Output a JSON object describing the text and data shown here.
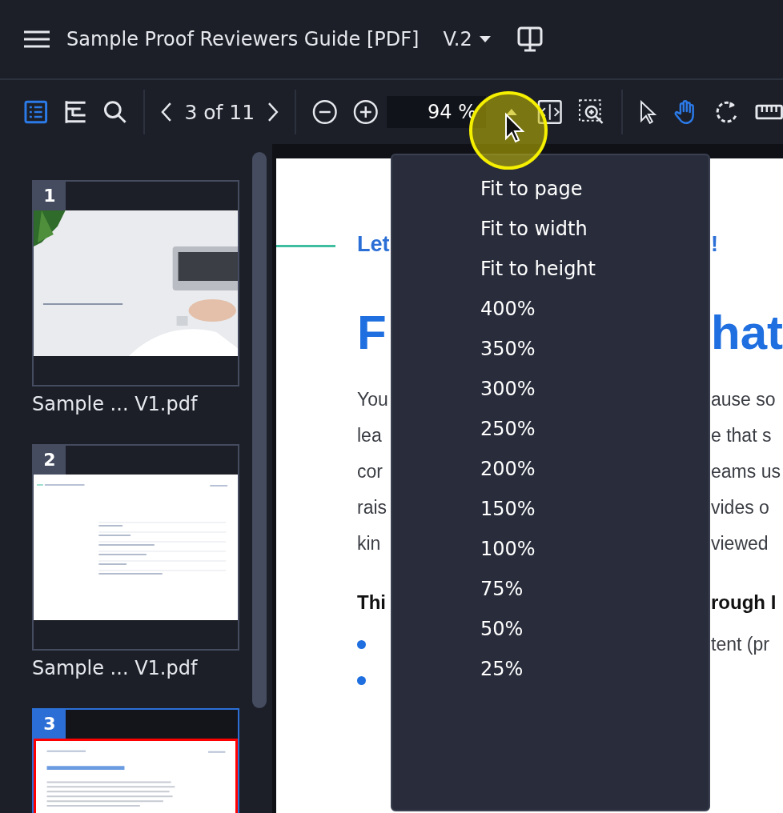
{
  "header": {
    "title": "Sample Proof Reviewers Guide [PDF]",
    "version": "V.2"
  },
  "toolbar": {
    "view_tools": [
      {
        "kind": "thumbnails",
        "selected": true
      },
      {
        "kind": "outline",
        "selected": false
      },
      {
        "kind": "search",
        "selected": false
      }
    ],
    "page_indicator": "3 of 11",
    "zoom": "94 %",
    "pointer_tools": [
      {
        "kind": "select",
        "selected": false
      },
      {
        "kind": "pan",
        "selected": true
      },
      {
        "kind": "rotate",
        "selected": false
      },
      {
        "kind": "measure",
        "selected": false
      }
    ]
  },
  "thumbnails": [
    {
      "number": "1",
      "label": "Sample ... V1.pdf",
      "selected": false,
      "kind": "picture"
    },
    {
      "number": "2",
      "label": "Sample ... V1.pdf",
      "selected": false,
      "kind": "contents"
    },
    {
      "number": "3",
      "selected": true,
      "kind": "article"
    }
  ],
  "document": {
    "kicker": {
      "left": "Let",
      "right": "!"
    },
    "heading": {
      "left": "F",
      "right": "hat"
    },
    "lines": [
      {
        "left": "You",
        "right": "ause so"
      },
      {
        "left": "lea",
        "right": "e that s"
      },
      {
        "left": "cor",
        "right": "eams us"
      },
      {
        "left": "rais",
        "right": "vides o"
      },
      {
        "left": "kin",
        "right": "viewed"
      }
    ],
    "subheading": {
      "left": "Thi",
      "right": "rough I"
    },
    "bullets": [
      {
        "kind": "bullet",
        "right": "tent (pr"
      },
      {
        "kind": "bullet"
      }
    ]
  },
  "zoom_menu": {
    "items": [
      "Fit to page",
      "Fit to width",
      "Fit to height",
      "400%",
      "350%",
      "300%",
      "250%",
      "200%",
      "150%",
      "100%",
      "75%",
      "50%",
      "25%"
    ]
  }
}
